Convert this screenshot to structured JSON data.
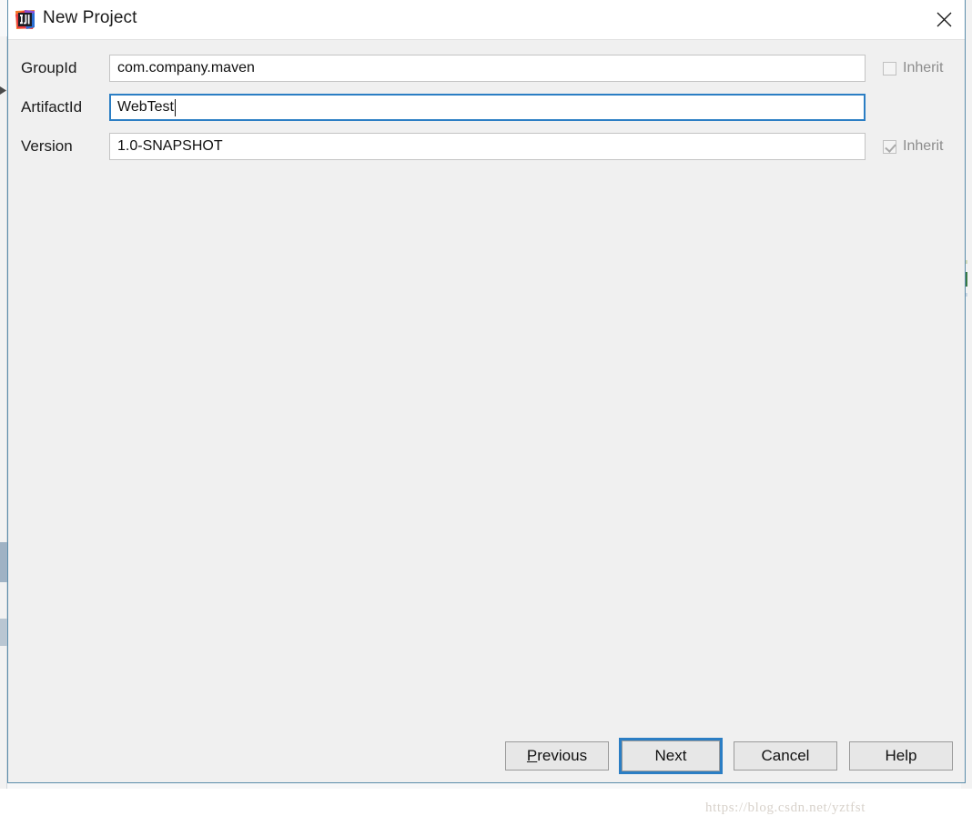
{
  "window": {
    "title": "New Project",
    "icon": "intellij-idea-logo-icon",
    "close_label": "×"
  },
  "form": {
    "rows": [
      {
        "label": "GroupId",
        "value": "com.company.maven",
        "focused": false,
        "inherit": {
          "label": "Inherit",
          "checked": false,
          "enabled": false,
          "visible": true
        }
      },
      {
        "label": "ArtifactId",
        "value": "WebTest",
        "focused": true,
        "inherit": {
          "label": "",
          "checked": false,
          "enabled": false,
          "visible": false
        }
      },
      {
        "label": "Version",
        "value": "1.0-SNAPSHOT",
        "focused": false,
        "inherit": {
          "label": "Inherit",
          "checked": true,
          "enabled": false,
          "visible": true
        }
      }
    ]
  },
  "buttons": {
    "previous": {
      "label": "Previous",
      "mnemonic": "P",
      "focused": false
    },
    "next": {
      "label": "Next",
      "mnemonic": "N",
      "focused": true
    },
    "cancel": {
      "label": "Cancel",
      "mnemonic": "",
      "focused": false
    },
    "help": {
      "label": "Help",
      "mnemonic": "",
      "focused": false
    }
  },
  "watermark": {
    "text": "https://blog.csdn.net/yztfst"
  },
  "colors": {
    "dialog_background": "#f0f0f0",
    "titlebar_background": "#ffffff",
    "focus_blue": "#2b7ec4",
    "dialog_border": "#5b8cab",
    "field_border": "#c4c4c4",
    "disabled_text": "#8d8d8d",
    "button_face": "#e7e7e7",
    "editor_marker_green": "#3a7a46"
  }
}
